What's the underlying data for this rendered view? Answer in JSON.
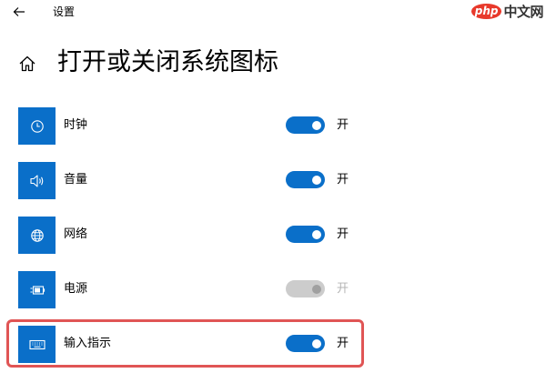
{
  "header": {
    "window_title": "设置",
    "watermark": {
      "badge": "php",
      "text": "中文网"
    }
  },
  "page": {
    "title": "打开或关闭系统图标"
  },
  "colors": {
    "accent": "#0a6fc9",
    "toggle_disabled": "#cccccc",
    "highlight": "#e05555"
  },
  "settings": [
    {
      "label": "时钟",
      "icon": "clock-icon",
      "state": "开",
      "on": true,
      "enabled": true
    },
    {
      "label": "音量",
      "icon": "speaker-icon",
      "state": "开",
      "on": true,
      "enabled": true
    },
    {
      "label": "网络",
      "icon": "globe-icon",
      "state": "开",
      "on": true,
      "enabled": true
    },
    {
      "label": "电源",
      "icon": "battery-icon",
      "state": "开",
      "on": true,
      "enabled": false
    },
    {
      "label": "输入指示",
      "icon": "keyboard-icon",
      "state": "开",
      "on": true,
      "enabled": true,
      "highlighted": true
    }
  ]
}
